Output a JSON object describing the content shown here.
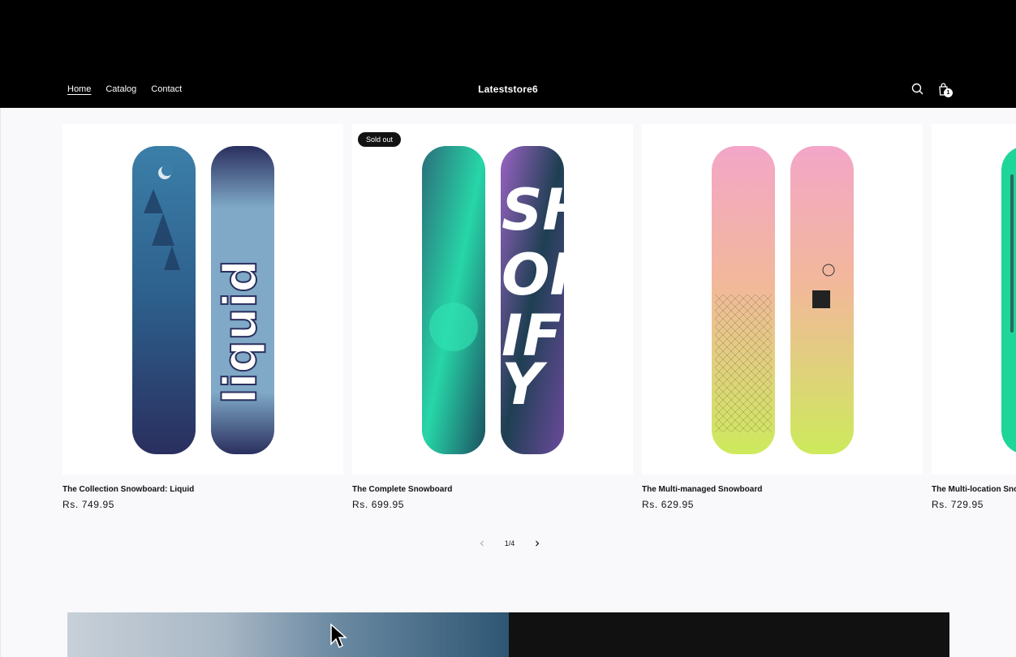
{
  "header": {
    "nav": [
      "Home",
      "Catalog",
      "Contact"
    ],
    "store_name": "Lateststore6",
    "cart_count": "1",
    "icons": [
      "search-icon",
      "cart-icon"
    ]
  },
  "products": [
    {
      "title": "The Collection Snowboard: Liquid",
      "price": "Rs. 749.95",
      "badge": ""
    },
    {
      "title": "The Complete Snowboard",
      "price": "Rs. 699.95",
      "badge": "Sold out"
    },
    {
      "title": "The Multi-managed Snowboard",
      "price": "Rs. 629.95",
      "badge": ""
    },
    {
      "title": "The Multi-location Snowboard",
      "price": "Rs. 729.95",
      "badge": ""
    }
  ],
  "pagination": {
    "label": "1/4"
  },
  "colors": {
    "header_bg": "#000000",
    "page_bg": "#f9f9fb",
    "badge_bg": "#121212"
  }
}
